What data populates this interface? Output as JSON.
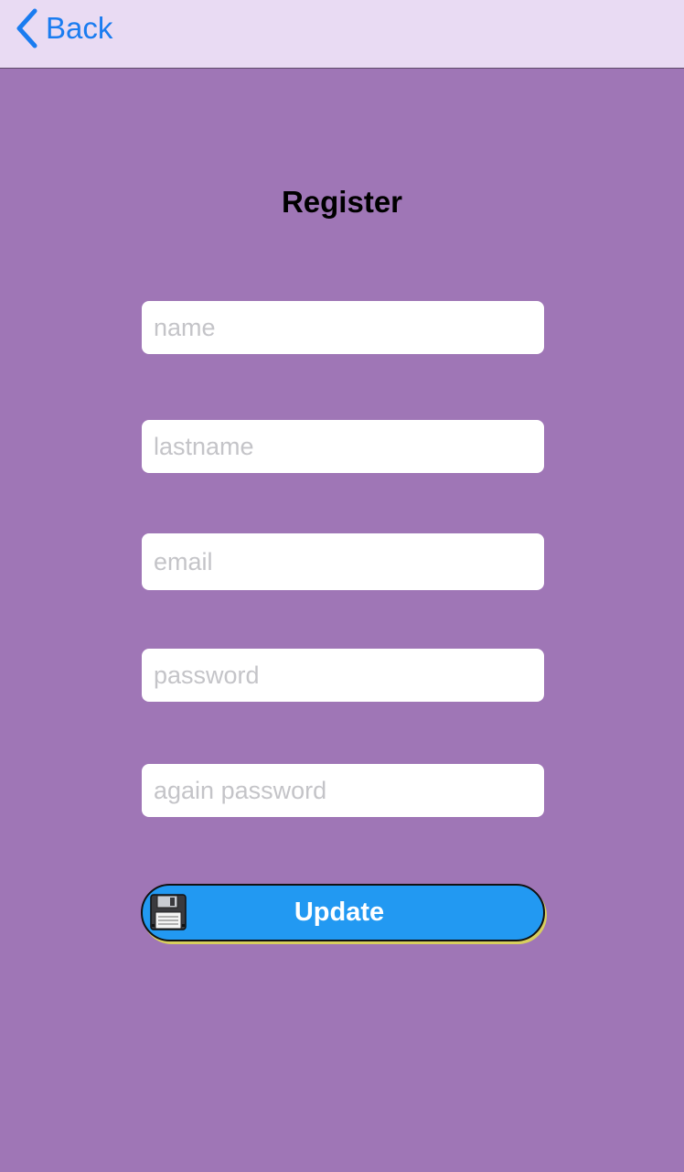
{
  "navbar": {
    "back_label": "Back"
  },
  "page": {
    "title": "Register"
  },
  "form": {
    "name": {
      "placeholder": "name",
      "value": ""
    },
    "lastname": {
      "placeholder": "lastname",
      "value": ""
    },
    "email": {
      "placeholder": "email",
      "value": ""
    },
    "password": {
      "placeholder": "password",
      "value": ""
    },
    "again_password": {
      "placeholder": "again password",
      "value": ""
    },
    "submit_label": "Update",
    "submit_icon": "floppy-disk-icon"
  },
  "colors": {
    "background": "#9f76b6",
    "navbar": "#e9dbf3",
    "link": "#1a7cf0",
    "button": "#2299f2",
    "button_shadow": "#d8cf5e"
  }
}
